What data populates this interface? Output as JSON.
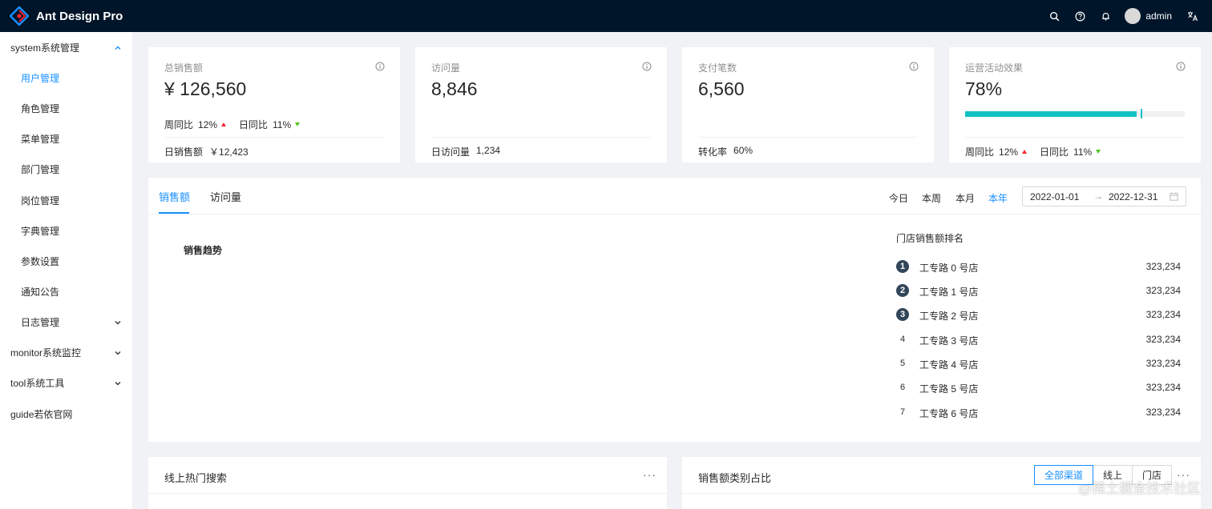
{
  "header": {
    "app_title": "Ant Design Pro",
    "user_name": "admin",
    "colors": {
      "bg": "#001529",
      "accent": "#1890ff"
    }
  },
  "sidebar": {
    "items": [
      {
        "label": "system系统管理",
        "level": "top",
        "expanded": true
      },
      {
        "label": "用户管理",
        "level": "sub",
        "active": true
      },
      {
        "label": "角色管理",
        "level": "sub"
      },
      {
        "label": "菜单管理",
        "level": "sub"
      },
      {
        "label": "部门管理",
        "level": "sub"
      },
      {
        "label": "岗位管理",
        "level": "sub"
      },
      {
        "label": "字典管理",
        "level": "sub"
      },
      {
        "label": "参数设置",
        "level": "sub"
      },
      {
        "label": "通知公告",
        "level": "sub"
      },
      {
        "label": "日志管理",
        "level": "sub",
        "has_children": true
      },
      {
        "label": "monitor系统监控",
        "level": "top",
        "has_children": true
      },
      {
        "label": "tool系统工具",
        "level": "top",
        "has_children": true
      },
      {
        "label": "guide若依官网",
        "level": "top"
      }
    ]
  },
  "stats": {
    "sales": {
      "title": "总销售额",
      "value": "¥ 126,560",
      "week_label": "周同比",
      "week_value": "12%",
      "day_label": "日同比",
      "day_value": "11%",
      "footer_label": "日销售额",
      "footer_value": "￥12,423"
    },
    "visits": {
      "title": "访问量",
      "value": "8,846",
      "footer_label": "日访问量",
      "footer_value": "1,234"
    },
    "payments": {
      "title": "支付笔数",
      "value": "6,560",
      "footer_label": "转化率",
      "footer_value": "60%"
    },
    "operations": {
      "title": "运营活动效果",
      "value": "78%",
      "progress_percent": 78,
      "target_percent": 80,
      "week_label": "周同比",
      "week_value": "12%",
      "day_label": "日同比",
      "day_value": "11%"
    }
  },
  "sales_panel": {
    "tabs": [
      "销售额",
      "访问量"
    ],
    "ranges": [
      "今日",
      "本周",
      "本月",
      "本年"
    ],
    "active_range": "本年",
    "date_start": "2022-01-01",
    "date_separator": "→",
    "date_end": "2022-12-31",
    "chart_title": "销售趋势",
    "rank_title": "门店销售额排名",
    "rank": [
      {
        "num": "1",
        "name": "工专路 0 号店",
        "value": "323,234"
      },
      {
        "num": "2",
        "name": "工专路 1 号店",
        "value": "323,234"
      },
      {
        "num": "3",
        "name": "工专路 2 号店",
        "value": "323,234"
      },
      {
        "num": "4",
        "name": "工专路 3 号店",
        "value": "323,234"
      },
      {
        "num": "5",
        "name": "工专路 4 号店",
        "value": "323,234"
      },
      {
        "num": "6",
        "name": "工专路 5 号店",
        "value": "323,234"
      },
      {
        "num": "7",
        "name": "工专路 6 号店",
        "value": "323,234"
      }
    ]
  },
  "bottom": {
    "search_title": "线上热门搜索",
    "category_title": "销售额类别占比",
    "channels": [
      "全部渠道",
      "线上",
      "门店"
    ],
    "more": "···"
  },
  "watermark": "@稀土掘金技术社区"
}
